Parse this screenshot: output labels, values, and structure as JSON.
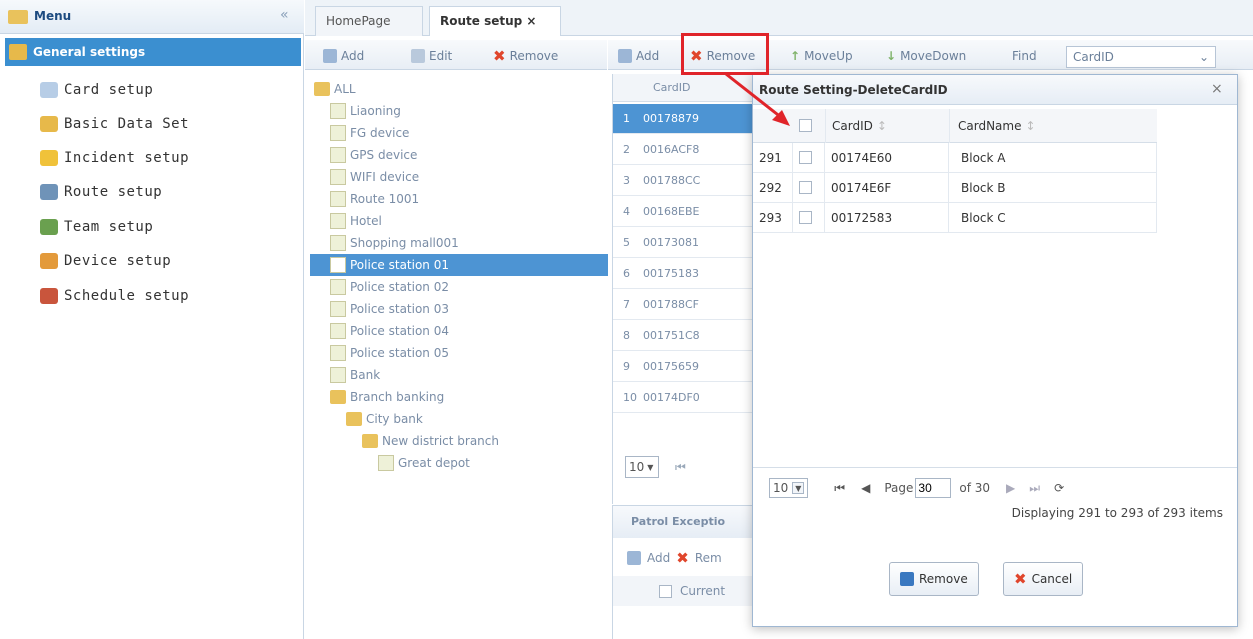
{
  "menu": {
    "title": "Menu",
    "collapse_glyph": "«",
    "section": "General settings",
    "items": [
      {
        "label": "Card setup",
        "icon": "card-icon",
        "color": "#b7cde6"
      },
      {
        "label": "Basic Data Set",
        "icon": "basic-data-icon",
        "color": "#e7b94a"
      },
      {
        "label": "Incident setup",
        "icon": "incident-icon",
        "color": "#f0c23a"
      },
      {
        "label": "Route setup",
        "icon": "route-icon",
        "color": "#6f93b8"
      },
      {
        "label": "Team setup",
        "icon": "team-icon",
        "color": "#6aa04f"
      },
      {
        "label": "Device setup",
        "icon": "device-icon",
        "color": "#e39a3b"
      },
      {
        "label": "Schedule setup",
        "icon": "schedule-icon",
        "color": "#c9553c"
      }
    ]
  },
  "tabs": [
    {
      "label": "HomePage"
    },
    {
      "label": "Route setup ×"
    }
  ],
  "tree_toolbar": {
    "add": "Add",
    "edit": "Edit",
    "remove": "Remove"
  },
  "grid_toolbar": {
    "add": "Add",
    "remove": "Remove",
    "moveup": "MoveUp",
    "movedown": "MoveDown",
    "find": "Find",
    "find_field": "CardID"
  },
  "tree": [
    {
      "label": "ALL",
      "level": 0,
      "type": "folder"
    },
    {
      "label": "Liaoning",
      "level": 1,
      "type": "page"
    },
    {
      "label": "FG device",
      "level": 1,
      "type": "page"
    },
    {
      "label": "GPS device",
      "level": 1,
      "type": "page"
    },
    {
      "label": "WIFI device",
      "level": 1,
      "type": "page"
    },
    {
      "label": "Route 1001",
      "level": 1,
      "type": "page"
    },
    {
      "label": "Hotel",
      "level": 1,
      "type": "page"
    },
    {
      "label": "Shopping mall001",
      "level": 1,
      "type": "page"
    },
    {
      "label": "Police station 01",
      "level": 1,
      "type": "page",
      "selected": true
    },
    {
      "label": "Police station 02",
      "level": 1,
      "type": "page"
    },
    {
      "label": "Police station 03",
      "level": 1,
      "type": "page"
    },
    {
      "label": "Police station 04",
      "level": 1,
      "type": "page"
    },
    {
      "label": "Police station 05",
      "level": 1,
      "type": "page"
    },
    {
      "label": "Bank",
      "level": 1,
      "type": "page"
    },
    {
      "label": "Branch banking",
      "level": 1,
      "type": "folder"
    },
    {
      "label": "City bank",
      "level": 2,
      "type": "folder"
    },
    {
      "label": "New district branch",
      "level": 3,
      "type": "folder"
    },
    {
      "label": "Great depot",
      "level": 4,
      "type": "page"
    }
  ],
  "grid": {
    "header": "CardID",
    "rows": [
      {
        "n": "1",
        "id": "00178879"
      },
      {
        "n": "2",
        "id": "0016ACF8"
      },
      {
        "n": "3",
        "id": "001788CC"
      },
      {
        "n": "4",
        "id": "00168EBE"
      },
      {
        "n": "5",
        "id": "00173081"
      },
      {
        "n": "6",
        "id": "00175183"
      },
      {
        "n": "7",
        "id": "001788CF"
      },
      {
        "n": "8",
        "id": "001751C8"
      },
      {
        "n": "9",
        "id": "00175659"
      },
      {
        "n": "10",
        "id": "00174DF0"
      }
    ],
    "page_size": "10"
  },
  "patrol": {
    "title": "Patrol Exceptio",
    "add": "Add",
    "remove": "Rem",
    "current": "Current"
  },
  "dialog": {
    "title": "Route Setting-DeleteCardID",
    "close": "×",
    "col_cardid": "CardID",
    "col_cardname": "CardName",
    "rows": [
      {
        "n": "291",
        "id": "00174E60",
        "name": "Block A"
      },
      {
        "n": "292",
        "id": "00174E6F",
        "name": "Block B"
      },
      {
        "n": "293",
        "id": "00172583",
        "name": "Block C"
      }
    ],
    "pager": {
      "size": "10",
      "page_label": "Page",
      "page": "30",
      "of": "of 30",
      "display": "Displaying 291 to 293 of 293 items"
    },
    "remove_btn": "Remove",
    "cancel_btn": "Cancel"
  },
  "accent": "#3b8fd0",
  "highlight": "#e0242a"
}
